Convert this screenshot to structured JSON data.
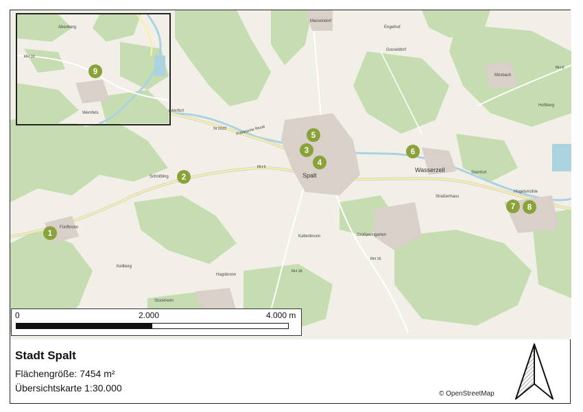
{
  "title": "Stadt Spalt",
  "area_label": "Flächengröße: 7454 m²",
  "overview_label": "Übersichtskarte 1:30.000",
  "attribution": "© OpenStreetMap",
  "scalebar": {
    "labels": [
      "0",
      "2.000",
      "4.000 m"
    ],
    "fill_fraction": 0.5
  },
  "markers": [
    {
      "number": "1"
    },
    {
      "number": "2"
    },
    {
      "number": "3"
    },
    {
      "number": "4"
    },
    {
      "number": "5"
    },
    {
      "number": "6"
    },
    {
      "number": "7"
    },
    {
      "number": "8"
    },
    {
      "number": "9"
    }
  ],
  "places": {
    "spalt": "Spalt",
    "wasserzell": "Wasserzell",
    "grossweingarten": "Großweingarten",
    "hagsbronn": "Hagsbronn",
    "stockheim": "Stockheim",
    "funfbronn": "Fünfbronn",
    "schnittling": "Schnittling",
    "mosbach": "Mosbach",
    "keilberg": "Keilberg",
    "kaltenbrunn": "Kaltenbrunn",
    "massendorf": "Massendorf",
    "gusseldorf": "Gusseldorf",
    "engelhof": "Engelhof",
    "steinfurt": "Steinfurt",
    "hugelsmuhle": "Hügelsmühle",
    "strassenhaus": "Straßenhaus",
    "lautenfurt": "Lautenfurt",
    "hoehberg": "Hohberg",
    "wernfels": "Wernfels",
    "abenberg": "Abenberg"
  },
  "roads": {
    "st2223": "St 2223",
    "rh6": "RH 6",
    "rh6_east": "RH 6",
    "rh16": "RH 16",
    "rh18": "RH 18",
    "rh10": "RH 10",
    "fraenkische_rezat": "Fränkische Rezat"
  },
  "colors": {
    "map_base": "#f2efe9",
    "forest": "#c4dcb0",
    "forest_dark": "#add19e",
    "water": "#aad3df",
    "road_yellow": "#f7f0a8",
    "marker": "#8aa23a",
    "settlement": "#d9d0c9"
  }
}
